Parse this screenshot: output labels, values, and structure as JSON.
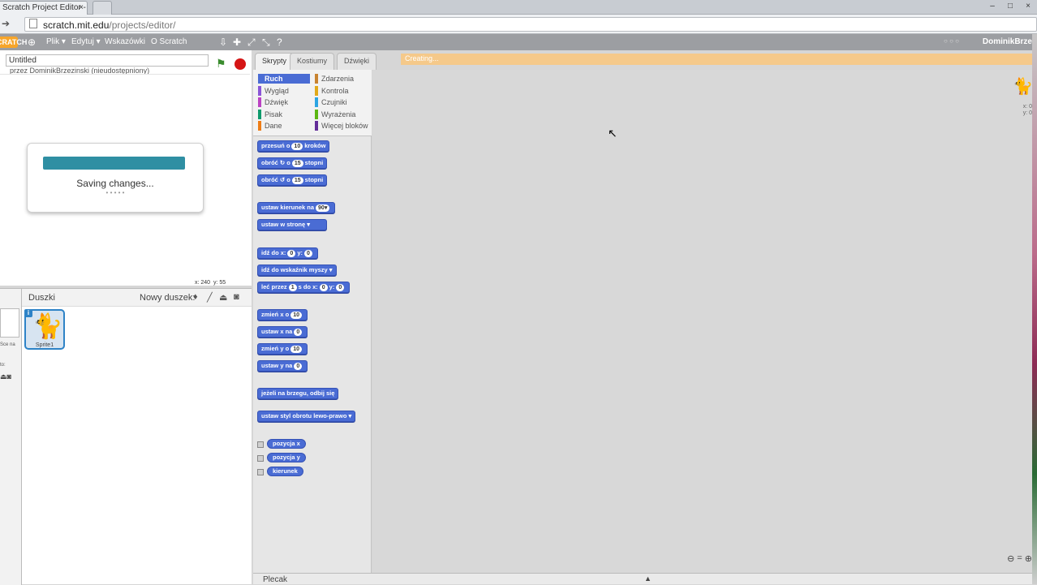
{
  "browser": {
    "tab_title": "Scratch Project Editor - Im",
    "tab_close": "×",
    "url_host": "scratch.mit.edu",
    "url_path": "/projects/editor/",
    "window_controls": [
      "–",
      "□",
      "×"
    ]
  },
  "menubar": {
    "logo": "CRATCH",
    "items": [
      "Plik ▾",
      "Edytuj ▾",
      "Wskazówki",
      "O Scratch"
    ],
    "user": "DominikBrze",
    "small_text": "○ ○ ○"
  },
  "stage": {
    "project_title": "Untitled",
    "author": "przez DominikBrzezinski (nieudostępniony)",
    "saving_text": "Saving changes...",
    "saving_dots": "• • • • •",
    "mouse_x": "x: 240",
    "mouse_y": "y: 55"
  },
  "sprites": {
    "title": "Duszki",
    "new_sprite_label": "Nowy duszek:",
    "sprite_name": "Sprite1",
    "sprite_info": "i",
    "thumb_label": "Sce na",
    "thumb_label2": "to:"
  },
  "editor_tabs": [
    "Skrypty",
    "Kostiumy",
    "Dźwięki"
  ],
  "creating_text": "Creating...",
  "categories": [
    {
      "label": "Ruch",
      "color": "#4a6cd4"
    },
    {
      "label": "Wygląd",
      "color": "#8a55d7"
    },
    {
      "label": "Dźwięk",
      "color": "#bb42c3"
    },
    {
      "label": "Pisak",
      "color": "#0e9a6c"
    },
    {
      "label": "Dane",
      "color": "#ee7d16"
    },
    {
      "label": "Zdarzenia",
      "color": "#c88330"
    },
    {
      "label": "Kontrola",
      "color": "#e1a91a"
    },
    {
      "label": "Czujniki",
      "color": "#2ca5e2"
    },
    {
      "label": "Wyrażenia",
      "color": "#5cb712"
    },
    {
      "label": "Więcej bloków",
      "color": "#632d99"
    }
  ],
  "blocks": {
    "b1_pre": "przesuń o",
    "b1_num": "10",
    "b1_post": "kroków",
    "b2_pre": "obróć ↻ o",
    "b2_num": "15",
    "b2_post": "stopni",
    "b3_pre": "obróć ↺ o",
    "b3_num": "15",
    "b3_post": "stopni",
    "b4_pre": "ustaw kierunek na",
    "b4_num": "90▾",
    "b5_pre": "ustaw w stronę",
    "b5_drop": "▾",
    "b6_pre": "idź do x:",
    "b6_x": "0",
    "b6_mid": "y:",
    "b6_y": "0",
    "b7_pre": "idź do",
    "b7_drop": "wskaźnik myszy ▾",
    "b8_pre": "leć przez",
    "b8_n": "1",
    "b8_mid": "s do x:",
    "b8_x": "0",
    "b8_mid2": "y:",
    "b8_y": "0",
    "b9_pre": "zmień x o",
    "b9_num": "10",
    "b10_pre": "ustaw x na",
    "b10_num": "0",
    "b11_pre": "zmień y o",
    "b11_num": "10",
    "b12_pre": "ustaw y na",
    "b12_num": "0",
    "b13": "jeżeli na brzegu, odbij się",
    "b14_pre": "ustaw styl obrotu",
    "b14_drop": "lewo-prawo ▾",
    "r1": "pozycja x",
    "r2": "pozycja y",
    "r3": "kierunek"
  },
  "script_area": {
    "corner_x": "x: 0",
    "corner_y": "y: 0",
    "zoom": [
      "⊖",
      "=",
      "⊕"
    ]
  },
  "backpack": {
    "label": "Plecak",
    "arrow": "▲"
  }
}
